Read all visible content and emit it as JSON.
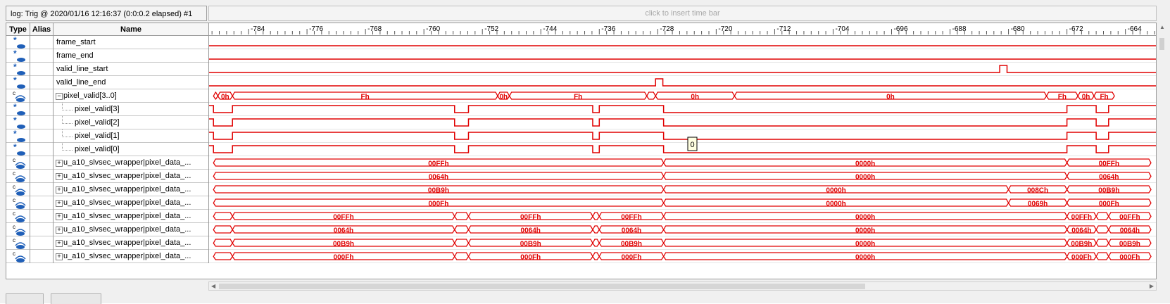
{
  "window": {
    "log_title": "log: Trig @ 2020/01/16 12:16:37 (0:0:0.2 elapsed) #1",
    "insert_hint": "click to insert time bar"
  },
  "columns": {
    "type": "Type",
    "alias": "Alias",
    "name": "Name"
  },
  "timeline": {
    "ticks": [
      "-784",
      "-776",
      "-768",
      "-760",
      "-752",
      "-744",
      "-736",
      "-728",
      "-720",
      "-712",
      "-704",
      "-696",
      "-688",
      "-680",
      "-672",
      "-664"
    ],
    "cursor_value": "0"
  },
  "signals": [
    {
      "name": "frame_start",
      "kind": "bit",
      "level": "low",
      "indent": 0
    },
    {
      "name": "frame_end",
      "kind": "bit",
      "level": "low",
      "indent": 0
    },
    {
      "name": "valid_line_start",
      "kind": "bit",
      "level": "low",
      "pulses": [
        [
          -681.2,
          -680.2
        ]
      ],
      "indent": 0
    },
    {
      "name": "valid_line_end",
      "kind": "bit",
      "level": "low",
      "pulses": [
        [
          -728.3,
          -727.3
        ]
      ],
      "indent": 0
    },
    {
      "name": "pixel_valid[3..0]",
      "kind": "bus",
      "expand": "minus",
      "indent": 0,
      "segments": [
        [
          "-788.8",
          "-788.2",
          "",
          ""
        ],
        [
          "-788.2",
          "-786.2",
          "0h",
          "narrow"
        ],
        [
          "-786.2",
          "-749.9",
          "Fh",
          ""
        ],
        [
          "-749.9",
          "-748.3",
          "0h",
          "narrow"
        ],
        [
          "-748.3",
          "-729.5",
          "Fh",
          ""
        ],
        [
          "-729.5",
          "-728.3",
          "",
          ""
        ],
        [
          "-728.3",
          "-717.5",
          "0h",
          ""
        ],
        [
          "-717.5",
          "-674.8",
          "0h",
          ""
        ],
        [
          "-674.8",
          "-670.5",
          "Fh",
          ""
        ],
        [
          "-670.5",
          "-668.3",
          "0h",
          "narrow"
        ],
        [
          "-668.3",
          "-665.5",
          "Fh",
          ""
        ]
      ]
    },
    {
      "name": "pixel_valid[3]",
      "kind": "bit",
      "level": "high",
      "lows": [
        [
          -788.8,
          -786.2
        ],
        [
          -755.8,
          -753.9
        ],
        [
          -736.9,
          -736.0
        ],
        [
          -727.2,
          -672.0
        ],
        [
          -668.0,
          -666.3
        ]
      ],
      "indent": 1
    },
    {
      "name": "pixel_valid[2]",
      "kind": "bit",
      "level": "high",
      "lows": [
        [
          -788.8,
          -786.2
        ],
        [
          -755.8,
          -753.9
        ],
        [
          -736.9,
          -736.0
        ],
        [
          -727.2,
          -672.0
        ],
        [
          -668.0,
          -666.3
        ]
      ],
      "indent": 1
    },
    {
      "name": "pixel_valid[1]",
      "kind": "bit",
      "level": "high",
      "lows": [
        [
          -788.8,
          -786.2
        ],
        [
          -755.8,
          -753.9
        ],
        [
          -736.9,
          -736.0
        ],
        [
          -727.2,
          -672.0
        ],
        [
          -668.0,
          -666.3
        ]
      ],
      "indent": 1
    },
    {
      "name": "pixel_valid[0]",
      "kind": "bit",
      "level": "high",
      "lows": [
        [
          -788.8,
          -786.2
        ],
        [
          -755.8,
          -753.9
        ],
        [
          -736.9,
          -736.0
        ],
        [
          -727.2,
          -672.0
        ],
        [
          -668.0,
          -666.3
        ]
      ],
      "indent": 1
    },
    {
      "name": "u_a10_slvsec_wrapper|pixel_data_...",
      "kind": "bus",
      "expand": "plus",
      "indent": 0,
      "segments": [
        [
          "-788.8",
          "-727.2",
          "00FFh",
          ""
        ],
        [
          "-727.2",
          "-672.0",
          "0000h",
          ""
        ],
        [
          "-672.0",
          "-660.5",
          "00FFh",
          ""
        ]
      ]
    },
    {
      "name": "u_a10_slvsec_wrapper|pixel_data_...",
      "kind": "bus",
      "expand": "plus",
      "indent": 0,
      "segments": [
        [
          "-788.8",
          "-727.2",
          "0064h",
          ""
        ],
        [
          "-727.2",
          "-672.0",
          "0000h",
          ""
        ],
        [
          "-672.0",
          "-660.5",
          "0064h",
          ""
        ]
      ]
    },
    {
      "name": "u_a10_slvsec_wrapper|pixel_data_...",
      "kind": "bus",
      "expand": "plus",
      "indent": 0,
      "segments": [
        [
          "-788.8",
          "-727.2",
          "00B9h",
          ""
        ],
        [
          "-727.2",
          "-680.0",
          "0000h",
          ""
        ],
        [
          "-680.0",
          "-672.0",
          "008Ch",
          ""
        ],
        [
          "-672.0",
          "-660.5",
          "00B9h",
          ""
        ]
      ]
    },
    {
      "name": "u_a10_slvsec_wrapper|pixel_data_...",
      "kind": "bus",
      "expand": "plus",
      "indent": 0,
      "segments": [
        [
          "-788.8",
          "-727.2",
          "000Fh",
          ""
        ],
        [
          "-727.2",
          "-680.0",
          "0000h",
          ""
        ],
        [
          "-680.0",
          "-672.0",
          "0069h",
          ""
        ],
        [
          "-672.0",
          "-660.5",
          "000Fh",
          ""
        ]
      ]
    },
    {
      "name": "u_a10_slvsec_wrapper|pixel_data_...",
      "kind": "bus",
      "expand": "plus",
      "indent": 0,
      "segments": [
        [
          "-788.8",
          "-786.2",
          "",
          ""
        ],
        [
          "-786.2",
          "-755.8",
          "00FFh",
          ""
        ],
        [
          "-755.8",
          "-753.9",
          "",
          ""
        ],
        [
          "-753.9",
          "-736.9",
          "00FFh",
          ""
        ],
        [
          "-736.9",
          "-736.0",
          "",
          ""
        ],
        [
          "-736.0",
          "-727.2",
          "00FFh",
          ""
        ],
        [
          "-727.2",
          "-672.0",
          "0000h",
          ""
        ],
        [
          "-672.0",
          "-668.0",
          "00FFh",
          ""
        ],
        [
          "-668.0",
          "-666.3",
          "",
          ""
        ],
        [
          "-666.3",
          "-660.5",
          "00FFh",
          ""
        ]
      ]
    },
    {
      "name": "u_a10_slvsec_wrapper|pixel_data_...",
      "kind": "bus",
      "expand": "plus",
      "indent": 0,
      "segments": [
        [
          "-788.8",
          "-786.2",
          "",
          ""
        ],
        [
          "-786.2",
          "-755.8",
          "0064h",
          ""
        ],
        [
          "-755.8",
          "-753.9",
          "",
          ""
        ],
        [
          "-753.9",
          "-736.9",
          "0064h",
          ""
        ],
        [
          "-736.9",
          "-736.0",
          "",
          ""
        ],
        [
          "-736.0",
          "-727.2",
          "0064h",
          ""
        ],
        [
          "-727.2",
          "-672.0",
          "0000h",
          ""
        ],
        [
          "-672.0",
          "-668.0",
          "0064h",
          ""
        ],
        [
          "-668.0",
          "-666.3",
          "",
          ""
        ],
        [
          "-666.3",
          "-660.5",
          "0064h",
          ""
        ]
      ]
    },
    {
      "name": "u_a10_slvsec_wrapper|pixel_data_...",
      "kind": "bus",
      "expand": "plus",
      "indent": 0,
      "segments": [
        [
          "-788.8",
          "-786.2",
          "",
          ""
        ],
        [
          "-786.2",
          "-755.8",
          "00B9h",
          ""
        ],
        [
          "-755.8",
          "-753.9",
          "",
          ""
        ],
        [
          "-753.9",
          "-736.9",
          "00B9h",
          ""
        ],
        [
          "-736.9",
          "-736.0",
          "",
          ""
        ],
        [
          "-736.0",
          "-727.2",
          "00B9h",
          ""
        ],
        [
          "-727.2",
          "-672.0",
          "0000h",
          ""
        ],
        [
          "-672.0",
          "-668.0",
          "00B9h",
          ""
        ],
        [
          "-668.0",
          "-666.3",
          "",
          ""
        ],
        [
          "-666.3",
          "-660.5",
          "00B9h",
          ""
        ]
      ]
    },
    {
      "name": "u_a10_slvsec_wrapper|pixel_data_...",
      "kind": "bus",
      "expand": "plus",
      "indent": 0,
      "segments": [
        [
          "-788.8",
          "-786.2",
          "",
          ""
        ],
        [
          "-786.2",
          "-755.8",
          "000Fh",
          ""
        ],
        [
          "-755.8",
          "-753.9",
          "",
          ""
        ],
        [
          "-753.9",
          "-736.9",
          "000Fh",
          ""
        ],
        [
          "-736.9",
          "-736.0",
          "",
          ""
        ],
        [
          "-736.0",
          "-727.2",
          "000Fh",
          ""
        ],
        [
          "-727.2",
          "-672.0",
          "0000h",
          ""
        ],
        [
          "-672.0",
          "-668.0",
          "000Fh",
          ""
        ],
        [
          "-668.0",
          "-666.3",
          "",
          ""
        ],
        [
          "-666.3",
          "-660.5",
          "000Fh",
          ""
        ]
      ]
    }
  ],
  "colors": {
    "wave": "#e00000",
    "grid": "#c8c8c8",
    "icon": "#1f5fb8"
  }
}
